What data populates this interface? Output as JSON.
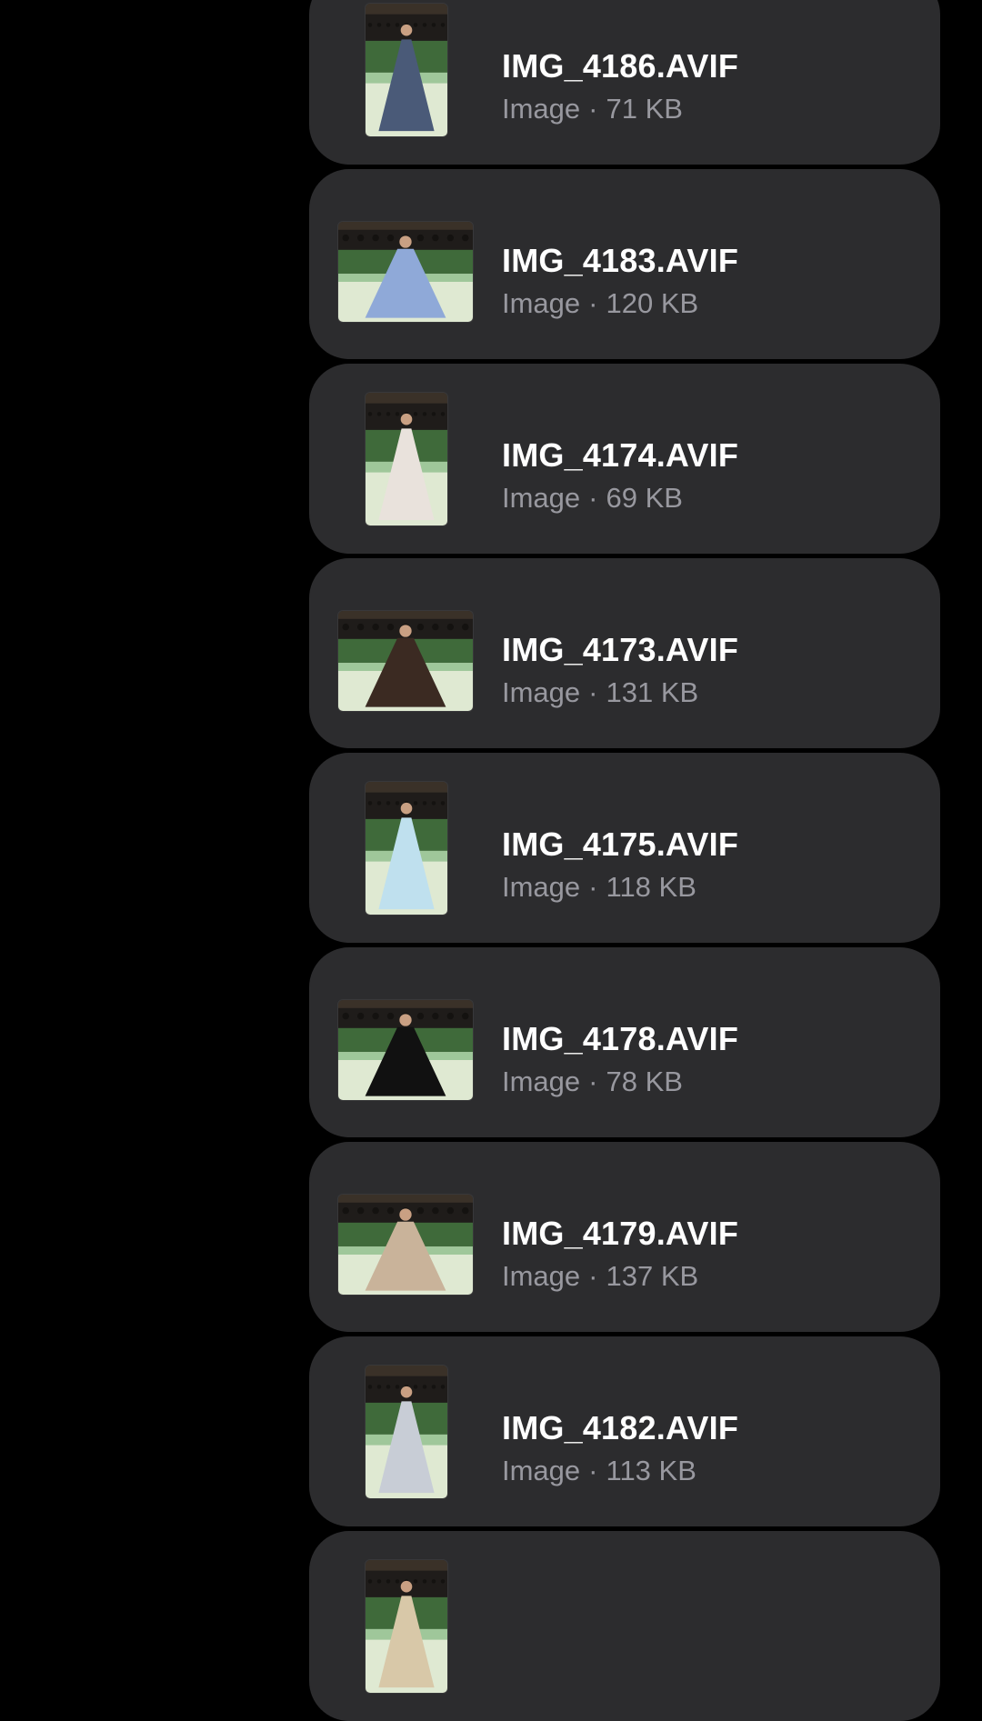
{
  "files": [
    {
      "name": "IMG_4186.AVIF",
      "kind": "Image",
      "size": "71 KB",
      "thumb": "portrait",
      "dress_color": "#4a5a78"
    },
    {
      "name": "IMG_4183.AVIF",
      "kind": "Image",
      "size": "120 KB",
      "thumb": "landscape",
      "dress_color": "#8fa9d8"
    },
    {
      "name": "IMG_4174.AVIF",
      "kind": "Image",
      "size": "69 KB",
      "thumb": "portrait",
      "dress_color": "#e9e2dc"
    },
    {
      "name": "IMG_4173.AVIF",
      "kind": "Image",
      "size": "131 KB",
      "thumb": "landscape",
      "dress_color": "#3b2a22"
    },
    {
      "name": "IMG_4175.AVIF",
      "kind": "Image",
      "size": "118 KB",
      "thumb": "portrait",
      "dress_color": "#bfe0ee"
    },
    {
      "name": "IMG_4178.AVIF",
      "kind": "Image",
      "size": "78 KB",
      "thumb": "landscape",
      "dress_color": "#111111"
    },
    {
      "name": "IMG_4179.AVIF",
      "kind": "Image",
      "size": "137 KB",
      "thumb": "landscape",
      "dress_color": "#c9b39a"
    },
    {
      "name": "IMG_4182.AVIF",
      "kind": "Image",
      "size": "113 KB",
      "thumb": "portrait",
      "dress_color": "#c8cdd6"
    },
    {
      "name": "",
      "kind": "",
      "size": "",
      "thumb": "portrait",
      "dress_color": "#d8c8a8"
    }
  ],
  "meta_separator": "·",
  "colors": {
    "background": "#000000",
    "card": "#2c2c2e",
    "title": "#ffffff",
    "subtitle": "#98989f"
  }
}
